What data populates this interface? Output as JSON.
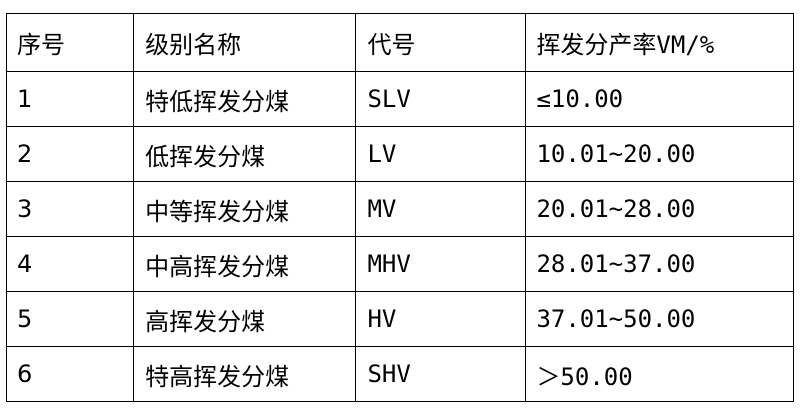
{
  "table": {
    "headers": [
      "序号",
      "级别名称",
      "代号",
      "挥发分产率VM/%"
    ],
    "rows": [
      {
        "no": "1",
        "name": "特低挥发分煤",
        "code": "SLV",
        "range": "≤10.00"
      },
      {
        "no": "2",
        "name": "低挥发分煤",
        "code": "LV",
        "range": "10.01~20.00"
      },
      {
        "no": "3",
        "name": "中等挥发分煤",
        "code": "MV",
        "range": "20.01~28.00"
      },
      {
        "no": "4",
        "name": "中高挥发分煤",
        "code": "MHV",
        "range": "28.01~37.00"
      },
      {
        "no": "5",
        "name": "高挥发分煤",
        "code": "HV",
        "range": "37.01~50.00"
      },
      {
        "no": "6",
        "name": "特高挥发分煤",
        "code": "SHV",
        "range": "＞50.00"
      }
    ]
  }
}
